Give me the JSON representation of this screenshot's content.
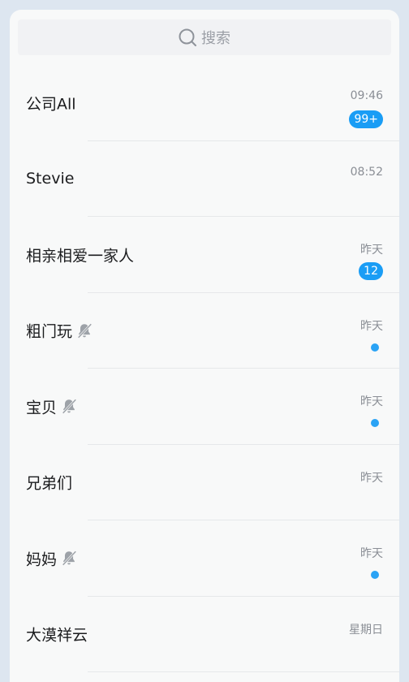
{
  "search": {
    "placeholder": "搜索",
    "icon": "search-icon"
  },
  "colors": {
    "accent": "#1a9df5",
    "background": "#f8f9f9"
  },
  "chats": [
    {
      "name": "公司All",
      "time": "09:46",
      "badge": "99+",
      "muted": false,
      "dot": false
    },
    {
      "name": "Stevie",
      "time": "08:52",
      "badge": null,
      "muted": false,
      "dot": false
    },
    {
      "name": "相亲相爱一家人",
      "time": "昨天",
      "badge": "12",
      "muted": false,
      "dot": false
    },
    {
      "name": "粗门玩",
      "time": "昨天",
      "badge": null,
      "muted": true,
      "dot": true
    },
    {
      "name": "宝贝",
      "time": "昨天",
      "badge": null,
      "muted": true,
      "dot": true
    },
    {
      "name": "兄弟们",
      "time": "昨天",
      "badge": null,
      "muted": false,
      "dot": false
    },
    {
      "name": "妈妈",
      "time": "昨天",
      "badge": null,
      "muted": true,
      "dot": true
    },
    {
      "name": "大漠祥云",
      "time": "星期日",
      "badge": null,
      "muted": false,
      "dot": false
    }
  ]
}
